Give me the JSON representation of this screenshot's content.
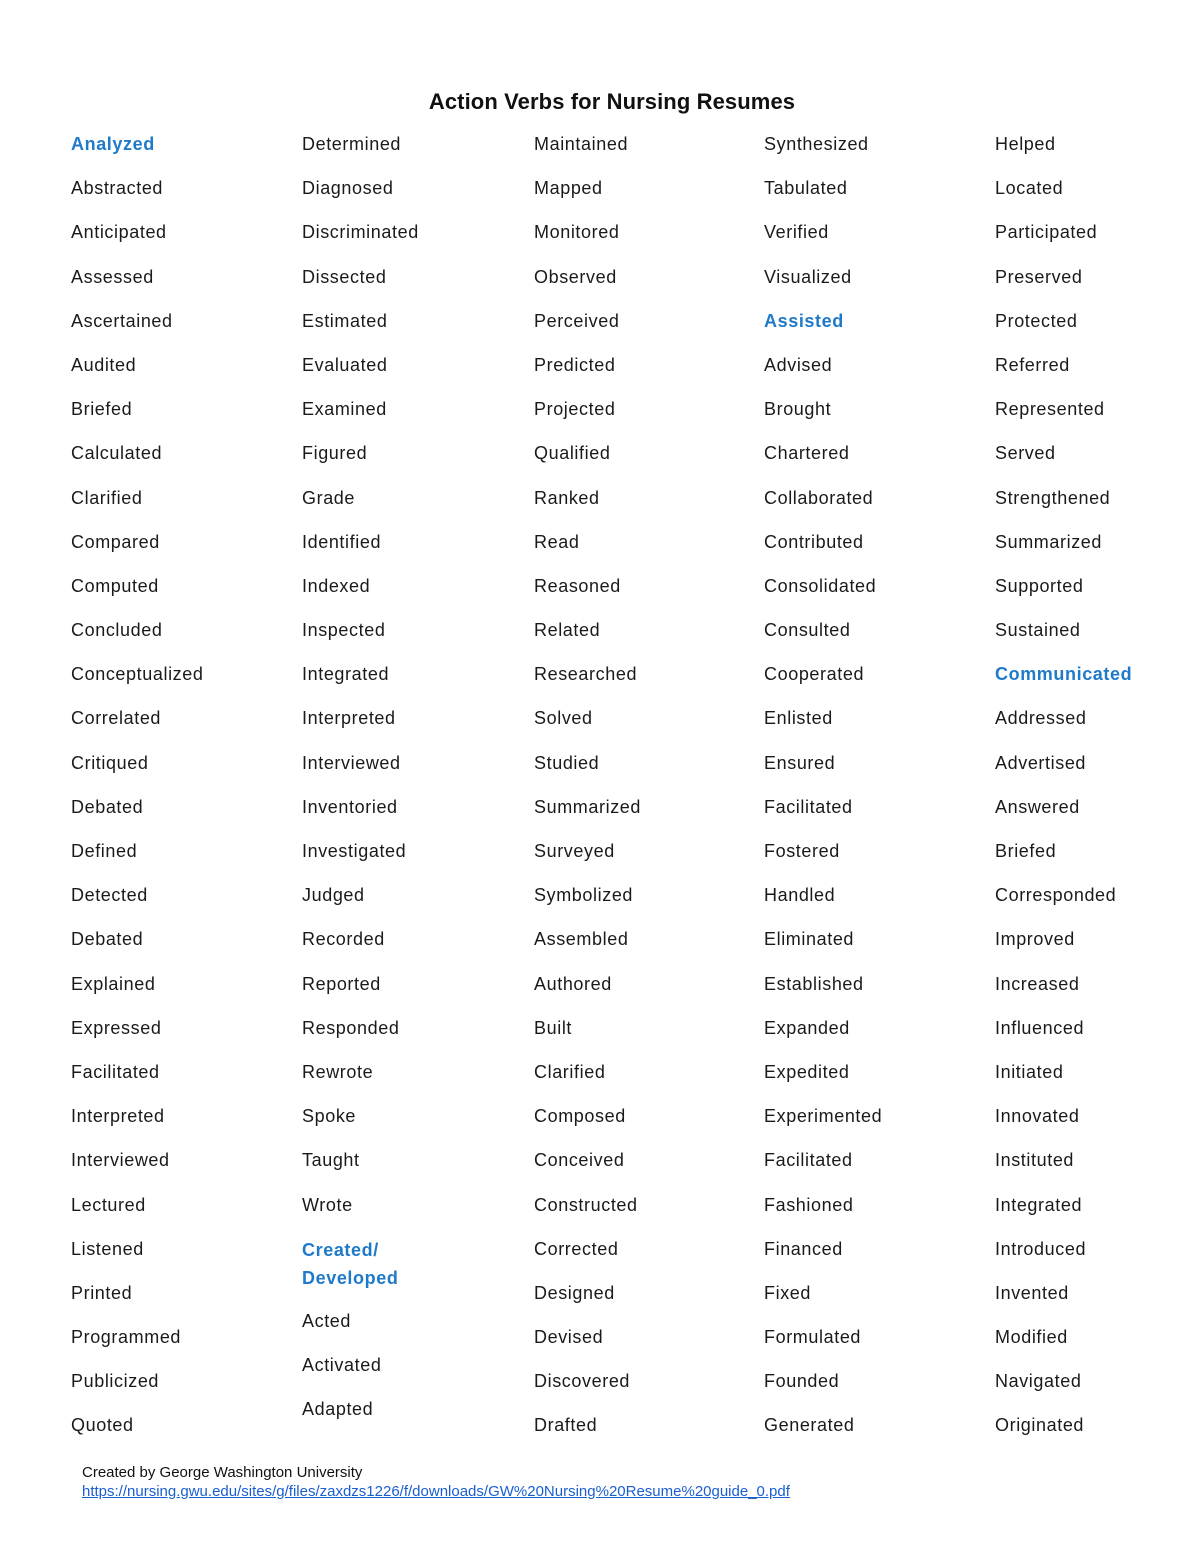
{
  "document": {
    "title": "Action Verbs for Nursing Resumes",
    "accent_color": "#1f7ac9",
    "columns": [
      {
        "words": [
          {
            "text": "Analyzed",
            "heading": true
          },
          {
            "text": "Abstracted"
          },
          {
            "text": "Anticipated"
          },
          {
            "text": "Assessed"
          },
          {
            "text": "Ascertained"
          },
          {
            "text": "Audited"
          },
          {
            "text": "Briefed"
          },
          {
            "text": "Calculated"
          },
          {
            "text": "Clarified"
          },
          {
            "text": "Compared"
          },
          {
            "text": "Computed"
          },
          {
            "text": "Concluded"
          },
          {
            "text": "Conceptualized"
          },
          {
            "text": "Correlated"
          },
          {
            "text": "Critiqued"
          },
          {
            "text": "Debated"
          },
          {
            "text": "Defined"
          },
          {
            "text": "Detected"
          },
          {
            "text": "Debated"
          },
          {
            "text": "Explained"
          },
          {
            "text": "Expressed"
          },
          {
            "text": "Facilitated"
          },
          {
            "text": "Interpreted"
          },
          {
            "text": "Interviewed"
          },
          {
            "text": "Lectured"
          },
          {
            "text": "Listened"
          },
          {
            "text": "Printed"
          },
          {
            "text": "Programmed"
          },
          {
            "text": "Publicized"
          },
          {
            "text": "Quoted"
          }
        ]
      },
      {
        "words": [
          {
            "text": "Determined"
          },
          {
            "text": "Diagnosed"
          },
          {
            "text": "Discriminated"
          },
          {
            "text": "Dissected"
          },
          {
            "text": "Estimated"
          },
          {
            "text": "Evaluated"
          },
          {
            "text": "Examined"
          },
          {
            "text": "Figured"
          },
          {
            "text": "Grade"
          },
          {
            "text": "Identified"
          },
          {
            "text": "Indexed"
          },
          {
            "text": "Inspected"
          },
          {
            "text": "Integrated"
          },
          {
            "text": "Interpreted"
          },
          {
            "text": "Interviewed"
          },
          {
            "text": "Inventoried"
          },
          {
            "text": "Investigated"
          },
          {
            "text": "Judged"
          },
          {
            "text": "Recorded"
          },
          {
            "text": "Reported"
          },
          {
            "text": "Responded"
          },
          {
            "text": "Rewrote"
          },
          {
            "text": "Spoke"
          },
          {
            "text": "Taught"
          },
          {
            "text": "Wrote"
          },
          {
            "text": "Created/ Developed",
            "heading": true
          },
          {
            "text": "Acted"
          },
          {
            "text": "Activated"
          },
          {
            "text": "Adapted"
          }
        ]
      },
      {
        "words": [
          {
            "text": "Maintained"
          },
          {
            "text": "Mapped"
          },
          {
            "text": "Monitored"
          },
          {
            "text": "Observed"
          },
          {
            "text": "Perceived"
          },
          {
            "text": "Predicted"
          },
          {
            "text": "Projected"
          },
          {
            "text": "Qualified"
          },
          {
            "text": "Ranked"
          },
          {
            "text": "Read"
          },
          {
            "text": "Reasoned"
          },
          {
            "text": "Related"
          },
          {
            "text": "Researched"
          },
          {
            "text": "Solved"
          },
          {
            "text": "Studied"
          },
          {
            "text": "Summarized"
          },
          {
            "text": "Surveyed"
          },
          {
            "text": "Symbolized"
          },
          {
            "text": "Assembled"
          },
          {
            "text": "Authored"
          },
          {
            "text": "Built"
          },
          {
            "text": "Clarified"
          },
          {
            "text": "Composed"
          },
          {
            "text": "Conceived"
          },
          {
            "text": "Constructed"
          },
          {
            "text": "Corrected"
          },
          {
            "text": "Designed"
          },
          {
            "text": "Devised"
          },
          {
            "text": "Discovered"
          },
          {
            "text": "Drafted"
          }
        ]
      },
      {
        "words": [
          {
            "text": "Synthesized"
          },
          {
            "text": "Tabulated"
          },
          {
            "text": "Verified"
          },
          {
            "text": "Visualized"
          },
          {
            "text": "Assisted",
            "heading": true
          },
          {
            "text": "Advised"
          },
          {
            "text": "Brought"
          },
          {
            "text": "Chartered"
          },
          {
            "text": "Collaborated"
          },
          {
            "text": "Contributed"
          },
          {
            "text": "Consolidated"
          },
          {
            "text": "Consulted"
          },
          {
            "text": "Cooperated"
          },
          {
            "text": "Enlisted"
          },
          {
            "text": "Ensured"
          },
          {
            "text": "Facilitated"
          },
          {
            "text": "Fostered"
          },
          {
            "text": "Handled"
          },
          {
            "text": "Eliminated"
          },
          {
            "text": "Established"
          },
          {
            "text": "Expanded"
          },
          {
            "text": "Expedited"
          },
          {
            "text": "Experimented"
          },
          {
            "text": "Facilitated"
          },
          {
            "text": "Fashioned"
          },
          {
            "text": "Financed"
          },
          {
            "text": "Fixed"
          },
          {
            "text": "Formulated"
          },
          {
            "text": "Founded"
          },
          {
            "text": "Generated"
          }
        ]
      },
      {
        "words": [
          {
            "text": "Helped"
          },
          {
            "text": "Located"
          },
          {
            "text": "Participated"
          },
          {
            "text": "Preserved"
          },
          {
            "text": "Protected"
          },
          {
            "text": "Referred"
          },
          {
            "text": "Represented"
          },
          {
            "text": "Served"
          },
          {
            "text": "Strengthened"
          },
          {
            "text": "Summarized"
          },
          {
            "text": "Supported"
          },
          {
            "text": "Sustained"
          },
          {
            "text": "Communicated",
            "heading": true
          },
          {
            "text": "Addressed"
          },
          {
            "text": "Advertised"
          },
          {
            "text": "Answered"
          },
          {
            "text": "Briefed"
          },
          {
            "text": "Corresponded"
          },
          {
            "text": "Improved"
          },
          {
            "text": "Increased"
          },
          {
            "text": "Influenced"
          },
          {
            "text": "Initiated"
          },
          {
            "text": "Innovated"
          },
          {
            "text": "Instituted"
          },
          {
            "text": "Integrated"
          },
          {
            "text": "Introduced"
          },
          {
            "text": "Invented"
          },
          {
            "text": "Modified"
          },
          {
            "text": "Navigated"
          },
          {
            "text": "Originated"
          }
        ]
      }
    ],
    "footer": {
      "credit": "Created by George Washington University",
      "link": "https://nursing.gwu.edu/sites/g/files/zaxdzs1226/f/downloads/GW%20Nursing%20Resume%20guide_0.pdf"
    }
  }
}
